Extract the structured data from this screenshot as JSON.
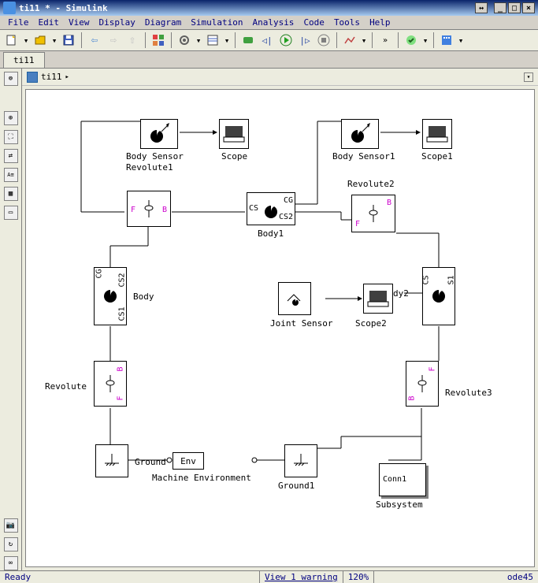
{
  "window": {
    "title": "ti11 * - Simulink",
    "icon_name": "simulink-icon"
  },
  "menu": {
    "items": [
      "File",
      "Edit",
      "View",
      "Display",
      "Diagram",
      "Simulation",
      "Analysis",
      "Code",
      "Tools",
      "Help"
    ]
  },
  "toolbar": {
    "new_tip": "New",
    "open_tip": "Open",
    "save_tip": "Save",
    "back_tip": "Back",
    "forward_tip": "Forward",
    "up_tip": "Up",
    "library_tip": "Library",
    "config_tip": "Config",
    "time_field": "",
    "loop_tip": "Loop",
    "step_back_tip": "Step Back",
    "run_tip": "Run",
    "step_forward_tip": "Step Forward",
    "stop_tip": "Stop",
    "plot_tip": "Plot",
    "check_tip": "Check",
    "build_tip": "Build"
  },
  "tabs": {
    "active": "ti11"
  },
  "breadcrumb": {
    "model": "ti11",
    "arrow": "▸"
  },
  "sidebar": {
    "icons": [
      "scope",
      "zoom",
      "fit",
      "scan",
      "aequ",
      "img",
      "rect"
    ],
    "bottom_icons": [
      "camera",
      "refresh",
      "loop"
    ]
  },
  "canvas": {
    "blocks": {
      "body_sensor": {
        "label": "Body Sensor"
      },
      "scope": {
        "label": "Scope"
      },
      "body_sensor1": {
        "label": "Body Sensor1"
      },
      "scope1": {
        "label": "Scope1"
      },
      "revolute1": {
        "label": "Revolute1"
      },
      "revolute2": {
        "label": "Revolute2"
      },
      "body1": {
        "label": "Body1",
        "ports": {
          "cs1": "CS",
          "cg": "CG",
          "cs2": "CS2"
        }
      },
      "body": {
        "label": "Body",
        "ports": {
          "cg": "CG",
          "cs2": "CS2",
          "cs1": "CS1"
        }
      },
      "joint_sensor": {
        "label": "Joint Sensor"
      },
      "scope2": {
        "label": "Scope2"
      },
      "body2": {
        "label": "dy2",
        "ports": {
          "cs": "CS",
          "s1": "S1"
        }
      },
      "revolute": {
        "label": "Revolute"
      },
      "revolute3": {
        "label": "Revolute3"
      },
      "ground": {
        "label": "Ground"
      },
      "machine_env": {
        "label": "Machine Environment",
        "text": "Env"
      },
      "ground1": {
        "label": "Ground1"
      },
      "subsystem": {
        "label": "Subsystem",
        "text": "Conn1"
      },
      "port_F": "F",
      "port_B": "B"
    }
  },
  "statusbar": {
    "ready": "Ready",
    "warning": "View 1 warning",
    "zoom": "120%",
    "solver": "ode45"
  }
}
